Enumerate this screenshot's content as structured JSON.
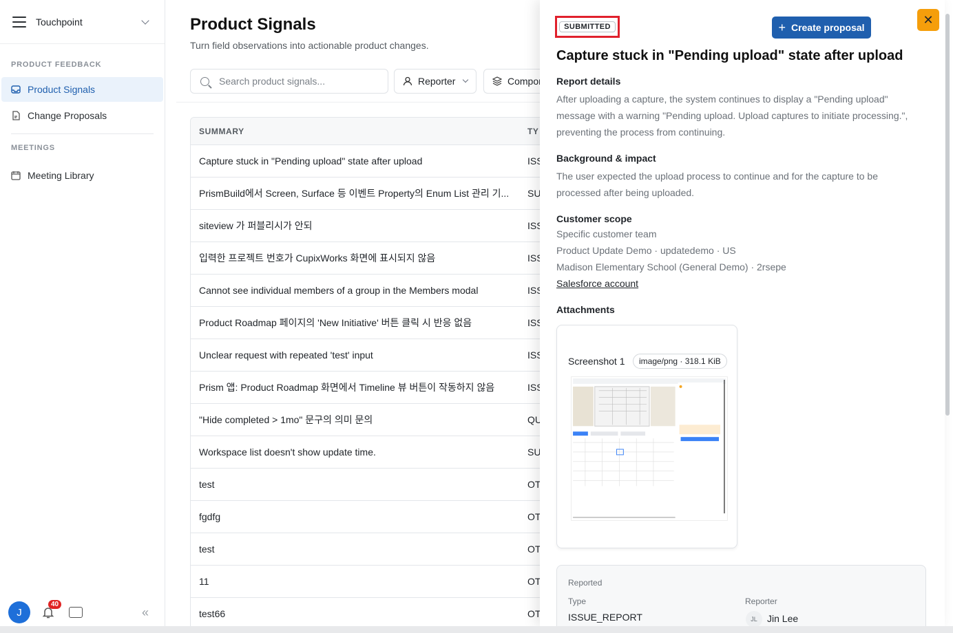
{
  "sidebar": {
    "workspace": "Touchpoint",
    "sections": [
      {
        "title": "PRODUCT FEEDBACK",
        "items": [
          "Product Signals",
          "Change Proposals"
        ]
      },
      {
        "title": "MEETINGS",
        "items": [
          "Meeting Library"
        ]
      }
    ],
    "avatar_initial": "J",
    "notification_count": "40",
    "collapse_glyph": "«"
  },
  "main": {
    "title": "Product Signals",
    "subtitle": "Turn field observations into actionable product changes.",
    "search_placeholder": "Search product signals...",
    "filters": [
      "Reporter",
      "Compon"
    ],
    "table": {
      "headers": [
        "SUMMARY",
        "TY"
      ],
      "rows": [
        [
          "Capture stuck in \"Pending upload\" state after upload",
          "ISS"
        ],
        [
          "PrismBuild에서 Screen, Surface 등 이벤트 Property의 Enum List 관리 기...",
          "SU"
        ],
        [
          "siteview 가 퍼블리시가 안되",
          "ISS"
        ],
        [
          "입력한 프로젝트 번호가 CupixWorks 화면에 표시되지 않음",
          "ISS"
        ],
        [
          "Cannot see individual members of a group in the Members modal",
          "ISS"
        ],
        [
          "Product Roadmap 페이지의 'New Initiative' 버튼 클릭 시 반응 없음",
          "ISS"
        ],
        [
          "Unclear request with repeated 'test' input",
          "ISS"
        ],
        [
          "Prism 앱: Product Roadmap 화면에서 Timeline 뷰 버튼이 작동하지 않음",
          "ISS"
        ],
        [
          "\"Hide completed > 1mo\" 문구의 의미 문의",
          "QU"
        ],
        [
          "Workspace list doesn't show update time.",
          "SU"
        ],
        [
          "test",
          "OT"
        ],
        [
          "fgdfg",
          "OT"
        ],
        [
          "test",
          "OT"
        ],
        [
          "11",
          "OT"
        ],
        [
          "test66",
          "OT"
        ]
      ]
    }
  },
  "panel": {
    "status": "SUBMITTED",
    "create_label": "Create proposal",
    "close_glyph": "✕",
    "title": "Capture stuck in \"Pending upload\" state after upload",
    "report_details": {
      "heading": "Report details",
      "text": "After uploading a capture, the system continues to display a \"Pending upload\" message with a warning \"Pending upload. Upload captures to initiate processing.\", preventing the process from continuing."
    },
    "background": {
      "heading": "Background & impact",
      "text": "The user expected the upload process to continue and for the capture to be processed after being uploaded."
    },
    "customer_scope": {
      "heading": "Customer scope",
      "lines": [
        "Specific customer team",
        "Product Update Demo · updatedemo · US",
        "Madison Elementary School (General Demo) · 2rsepe"
      ],
      "link": "Salesforce account"
    },
    "attachments": {
      "heading": "Attachments",
      "name": "Screenshot 1",
      "meta": "image/png · 318.1 KiB"
    },
    "reported": {
      "heading": "Reported",
      "type_label": "Type",
      "type_value": "ISSUE_REPORT",
      "reporter_label": "Reporter",
      "reporter_initials": "JL",
      "reporter_name": "Jin Lee"
    }
  },
  "colors": {
    "accent": "#1f5fae",
    "status_outline": "#e0202c",
    "close": "#f59e0b"
  }
}
